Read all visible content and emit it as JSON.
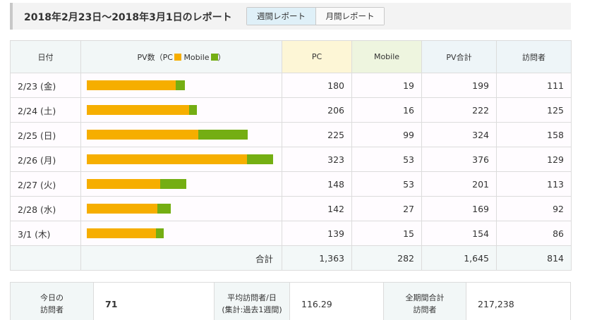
{
  "header": {
    "title": "2018年2月23日〜2018年3月1日のレポート",
    "tabs": [
      "週間レポート",
      "月間レポート"
    ],
    "active_tab": 0
  },
  "table": {
    "headers": {
      "date": "日付",
      "pv": "PV数（PC",
      "mobile_legend": "Mobile",
      "close": "）",
      "pc": "PC",
      "mobile": "Mobile",
      "pv_total": "PV合計",
      "visitors": "訪問者"
    },
    "bar_max": 376,
    "rows": [
      {
        "date": "2/23 (金)",
        "pc": "180",
        "mobile": "19",
        "pv_total": "199",
        "visitors": "111",
        "pc_value": 180,
        "mobile_value": 19
      },
      {
        "date": "2/24 (土)",
        "pc": "206",
        "mobile": "16",
        "pv_total": "222",
        "visitors": "125",
        "pc_value": 206,
        "mobile_value": 16
      },
      {
        "date": "2/25 (日)",
        "pc": "225",
        "mobile": "99",
        "pv_total": "324",
        "visitors": "158",
        "pc_value": 225,
        "mobile_value": 99
      },
      {
        "date": "2/26 (月)",
        "pc": "323",
        "mobile": "53",
        "pv_total": "376",
        "visitors": "129",
        "pc_value": 323,
        "mobile_value": 53
      },
      {
        "date": "2/27 (火)",
        "pc": "148",
        "mobile": "53",
        "pv_total": "201",
        "visitors": "113",
        "pc_value": 148,
        "mobile_value": 53
      },
      {
        "date": "2/28 (水)",
        "pc": "142",
        "mobile": "27",
        "pv_total": "169",
        "visitors": "92",
        "pc_value": 142,
        "mobile_value": 27
      },
      {
        "date": "3/1 (木)",
        "pc": "139",
        "mobile": "15",
        "pv_total": "154",
        "visitors": "86",
        "pc_value": 139,
        "mobile_value": 15
      }
    ],
    "total": {
      "label": "合計",
      "pc": "1,363",
      "mobile": "282",
      "pv_total": "1,645",
      "visitors": "814"
    }
  },
  "stats": {
    "today_label_1": "今日の",
    "today_label_2": "訪問者",
    "today_value": "71",
    "avg_label_1": "平均訪問者/日",
    "avg_label_2": "(集計:過去1週間)",
    "avg_value": "116.29",
    "all_label_1": "全期間合計",
    "all_label_2": "訪問者",
    "all_value": "217,238"
  },
  "colors": {
    "pc": "#f6ae00",
    "mobile": "#74ae13"
  }
}
